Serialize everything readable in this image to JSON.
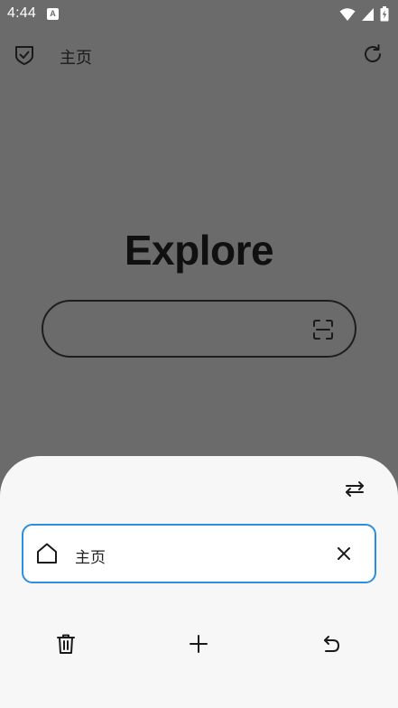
{
  "status_bar": {
    "time": "4:44",
    "app_icon_letter": "A",
    "icons": [
      "wifi-icon",
      "signal-icon",
      "battery-charging-icon"
    ]
  },
  "top_bar": {
    "title": "主页",
    "left_icon": "shield-check-icon",
    "right_icon": "refresh-icon"
  },
  "main": {
    "heading": "Explore",
    "search": {
      "value": "",
      "placeholder": "",
      "icon": "scan-icon"
    }
  },
  "bottom_sheet": {
    "swap_icon": "swap-icon",
    "tabs": [
      {
        "label": "主页",
        "icon": "home-icon",
        "close_icon": "close-icon",
        "active": true
      }
    ],
    "actions": [
      {
        "name": "delete-all",
        "icon": "trash-icon"
      },
      {
        "name": "new-tab",
        "icon": "plus-icon"
      },
      {
        "name": "undo",
        "icon": "undo-icon"
      }
    ],
    "accent_color": "#2a8fe0"
  },
  "colors": {
    "scrim_background": "#6b6b6b",
    "sheet_background": "#f7f7f7"
  }
}
